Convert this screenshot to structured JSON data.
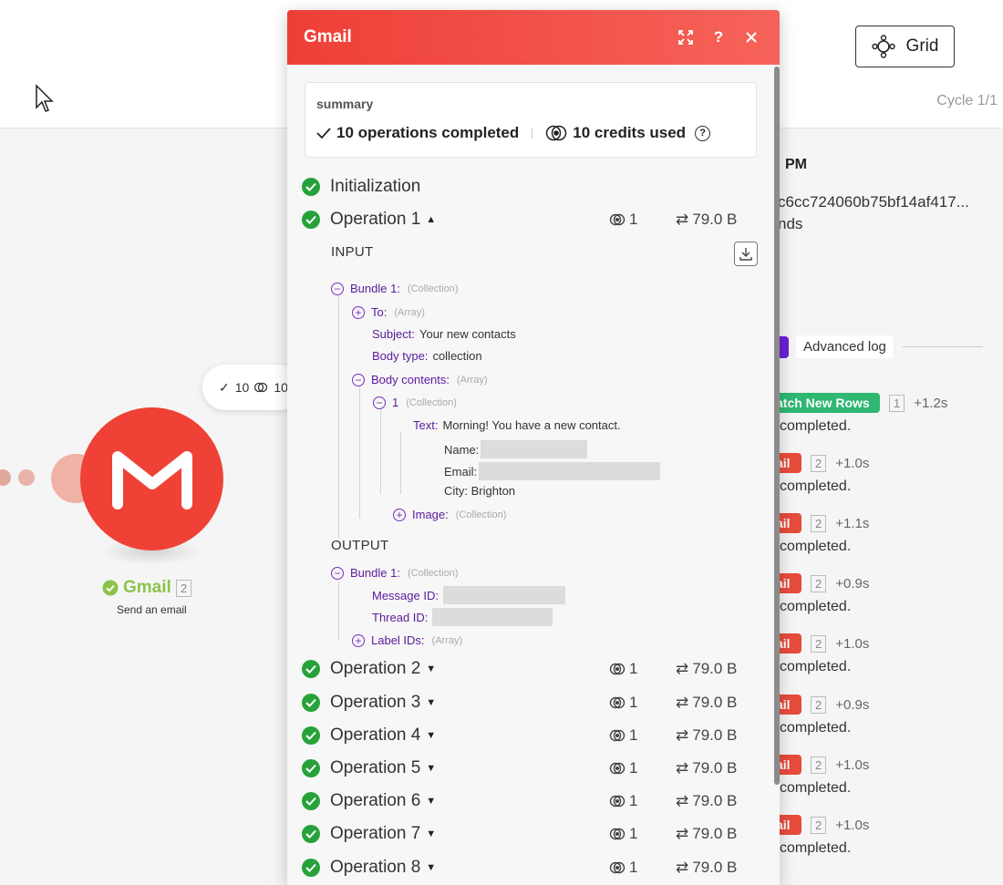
{
  "topbar": {
    "grid_label": "Grid",
    "cycle_label": "Cycle 1/1"
  },
  "canvas": {
    "module_name": "Gmail",
    "module_badge": "2",
    "module_subtitle": "Send an email",
    "bubble_ops": "10",
    "bubble_credits": "10"
  },
  "right_panel": {
    "time": "PM",
    "hash": "c6cc724060b75bf14af417...",
    "seconds": "nds",
    "advanced_log_label": "Advanced log",
    "entries": [
      {
        "tag": "atch New Rows",
        "num": "1",
        "delta": "+1.2s",
        "text": "completed."
      },
      {
        "tag": "ail",
        "num": "2",
        "delta": "+1.0s",
        "text": "completed."
      },
      {
        "tag": "ail",
        "num": "2",
        "delta": "+1.1s",
        "text": "completed."
      },
      {
        "tag": "ail",
        "num": "2",
        "delta": "+0.9s",
        "text": "completed."
      },
      {
        "tag": "ail",
        "num": "2",
        "delta": "+1.0s",
        "text": "completed."
      },
      {
        "tag": "ail",
        "num": "2",
        "delta": "+0.9s",
        "text": "completed."
      },
      {
        "tag": "ail",
        "num": "2",
        "delta": "+1.0s",
        "text": "completed."
      },
      {
        "tag": "ail",
        "num": "2",
        "delta": "+1.0s",
        "text": "completed."
      }
    ]
  },
  "dialog": {
    "title": "Gmail",
    "summary_title": "summary",
    "ops_completed": "10 operations completed",
    "credits_used": "10 credits used",
    "initialization": "Initialization",
    "operation_1": {
      "label": "Operation 1",
      "credits": "1",
      "size": "79.0 B"
    },
    "input_label": "INPUT",
    "output_label": "OUTPUT",
    "input_tree": {
      "bundle": {
        "key": "Bundle 1:",
        "type": "(Collection)"
      },
      "to": {
        "key": "To:",
        "type": "(Array)"
      },
      "subject": {
        "key": "Subject:",
        "value": "Your new contacts"
      },
      "body_type": {
        "key": "Body type:",
        "value": "collection"
      },
      "body_contents": {
        "key": "Body contents:",
        "type": "(Array)"
      },
      "item": {
        "key": "1",
        "type": "(Collection)"
      },
      "text": {
        "key": "Text:",
        "value": "Morning! You have a new contact."
      },
      "name_line": "Name:",
      "email_line": "Email:",
      "city_line": "City: Brighton",
      "image": {
        "key": "Image:",
        "type": "(Collection)"
      }
    },
    "output_tree": {
      "bundle": {
        "key": "Bundle 1:",
        "type": "(Collection)"
      },
      "message_id": {
        "key": "Message ID:"
      },
      "thread_id": {
        "key": "Thread ID:"
      },
      "label_ids": {
        "key": "Label IDs:",
        "type": "(Array)"
      }
    },
    "operations": [
      {
        "label": "Operation 2",
        "credits": "1",
        "size": "79.0 B"
      },
      {
        "label": "Operation 3",
        "credits": "1",
        "size": "79.0 B"
      },
      {
        "label": "Operation 4",
        "credits": "1",
        "size": "79.0 B"
      },
      {
        "label": "Operation 5",
        "credits": "1",
        "size": "79.0 B"
      },
      {
        "label": "Operation 6",
        "credits": "1",
        "size": "79.0 B"
      },
      {
        "label": "Operation 7",
        "credits": "1",
        "size": "79.0 B"
      },
      {
        "label": "Operation 8",
        "credits": "1",
        "size": "79.0 B"
      }
    ]
  }
}
